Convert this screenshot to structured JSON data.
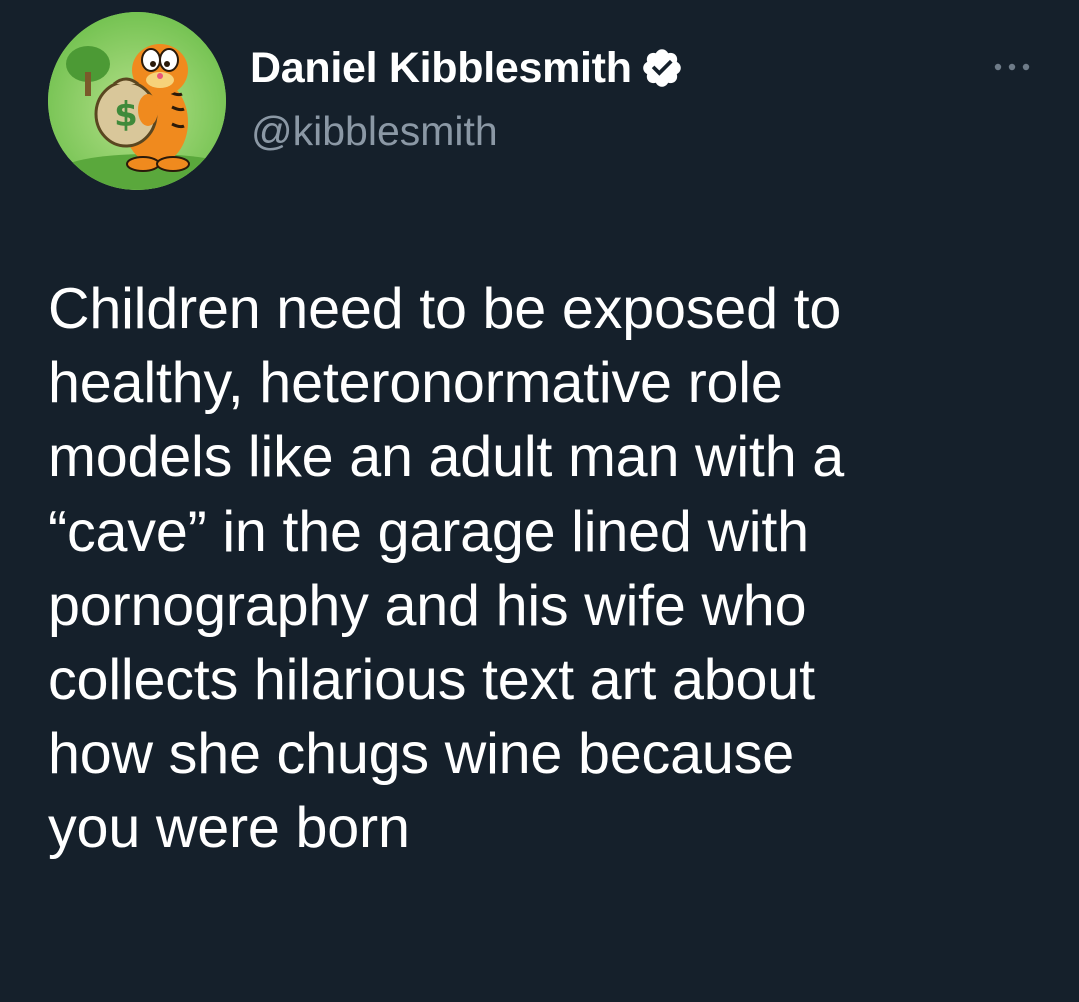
{
  "tweet": {
    "author": {
      "display_name": "Daniel Kibblesmith",
      "handle": "@kibblesmith",
      "verified": true,
      "avatar_icon": "cartoon-cat-holding-money-bag-avatar"
    },
    "text": "Children need to be exposed to\nhealthy, heteronormative role\nmodels like an adult man with a\n“cave” in the garage lined with\npornography and his wife who\ncollects hilarious text art about\nhow she chugs wine because\nyou were born"
  },
  "icons": {
    "verified": "verified-badge-icon",
    "more": "more-options-icon"
  },
  "colors": {
    "background": "#15202b",
    "text": "#ffffff",
    "secondary_text": "#8b98a5",
    "avatar_background": "#8fd36a"
  }
}
